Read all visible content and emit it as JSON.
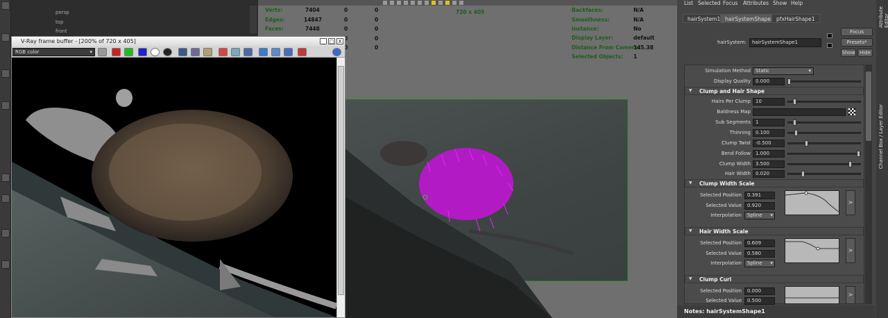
{
  "outliner": {
    "items": [
      "persp",
      "top",
      "front"
    ]
  },
  "viewport": {
    "resolution_gate": "720 x 405",
    "hud_left": [
      {
        "label": "Verts:",
        "v1": "7404",
        "v2": "0",
        "v3": "0"
      },
      {
        "label": "Edges:",
        "v1": "14847",
        "v2": "0",
        "v3": "0"
      },
      {
        "label": "Faces:",
        "v1": "7448",
        "v2": "0",
        "v3": "0"
      },
      {
        "label": "",
        "v1": "",
        "v2": "0",
        "v3": "0"
      },
      {
        "label": "",
        "v1": "",
        "v2": "0",
        "v3": "0"
      }
    ],
    "hud_right": [
      {
        "label": "Backfaces:",
        "value": "N/A"
      },
      {
        "label": "Smoothness:",
        "value": "N/A"
      },
      {
        "label": "Instance:",
        "value": "No"
      },
      {
        "label": "Display Layer:",
        "value": "default"
      },
      {
        "label": "Distance From Camera:",
        "value": "145.38"
      },
      {
        "label": "Selected Objects:",
        "value": "1"
      }
    ]
  },
  "vfb": {
    "title": "V-Ray frame buffer - [200% of 720 x 405]",
    "channel": "RGB color",
    "min": "_",
    "max": "□",
    "close": "X"
  },
  "attr_editor": {
    "menu": [
      "List",
      "Selected",
      "Focus",
      "Attributes",
      "Show",
      "Help"
    ],
    "tabs": [
      "hairSystem1",
      "hairSystemShape1",
      "pfxHairShape1"
    ],
    "node_label": "hairSystem:",
    "node_value": "hairSystemShape1",
    "buttons": {
      "focus": "Focus",
      "presets": "Presets*",
      "show": "Show",
      "hide": "Hide"
    },
    "sim_method_label": "Simulation Method",
    "sim_method_value": "Static",
    "display_quality_label": "Display Quality",
    "display_quality_value": "0.000",
    "clump_section": "Clump and Hair Shape",
    "clump_attrs": [
      {
        "label": "Hairs Per Clump",
        "value": "10"
      },
      {
        "label": "Baldness Map",
        "value": ""
      },
      {
        "label": "Sub Segments",
        "value": "1"
      },
      {
        "label": "Thinning",
        "value": "0.100"
      },
      {
        "label": "Clump Twist",
        "value": "-0.500"
      },
      {
        "label": "Bend Follow",
        "value": "1.000"
      },
      {
        "label": "Clump Width",
        "value": "3.500"
      },
      {
        "label": "Hair Width",
        "value": "0.020"
      }
    ],
    "ramps": [
      {
        "title": "Clump Width Scale",
        "pos": "0.391",
        "val": "0.920",
        "interp": "Spline"
      },
      {
        "title": "Hair Width Scale",
        "pos": "0.609",
        "val": "0.580",
        "interp": "Spline"
      },
      {
        "title": "Clump Curl",
        "pos": "0.000",
        "val": "0.500",
        "interp": ""
      }
    ],
    "ramp_labels": {
      "pos": "Selected Position",
      "val": "Selected Value",
      "interp": "Interpolation"
    },
    "notes": "Notes:  hairSystemShape1",
    "side_tabs": [
      "Channel Box / Layer Editor",
      "Attribute Editor"
    ]
  }
}
